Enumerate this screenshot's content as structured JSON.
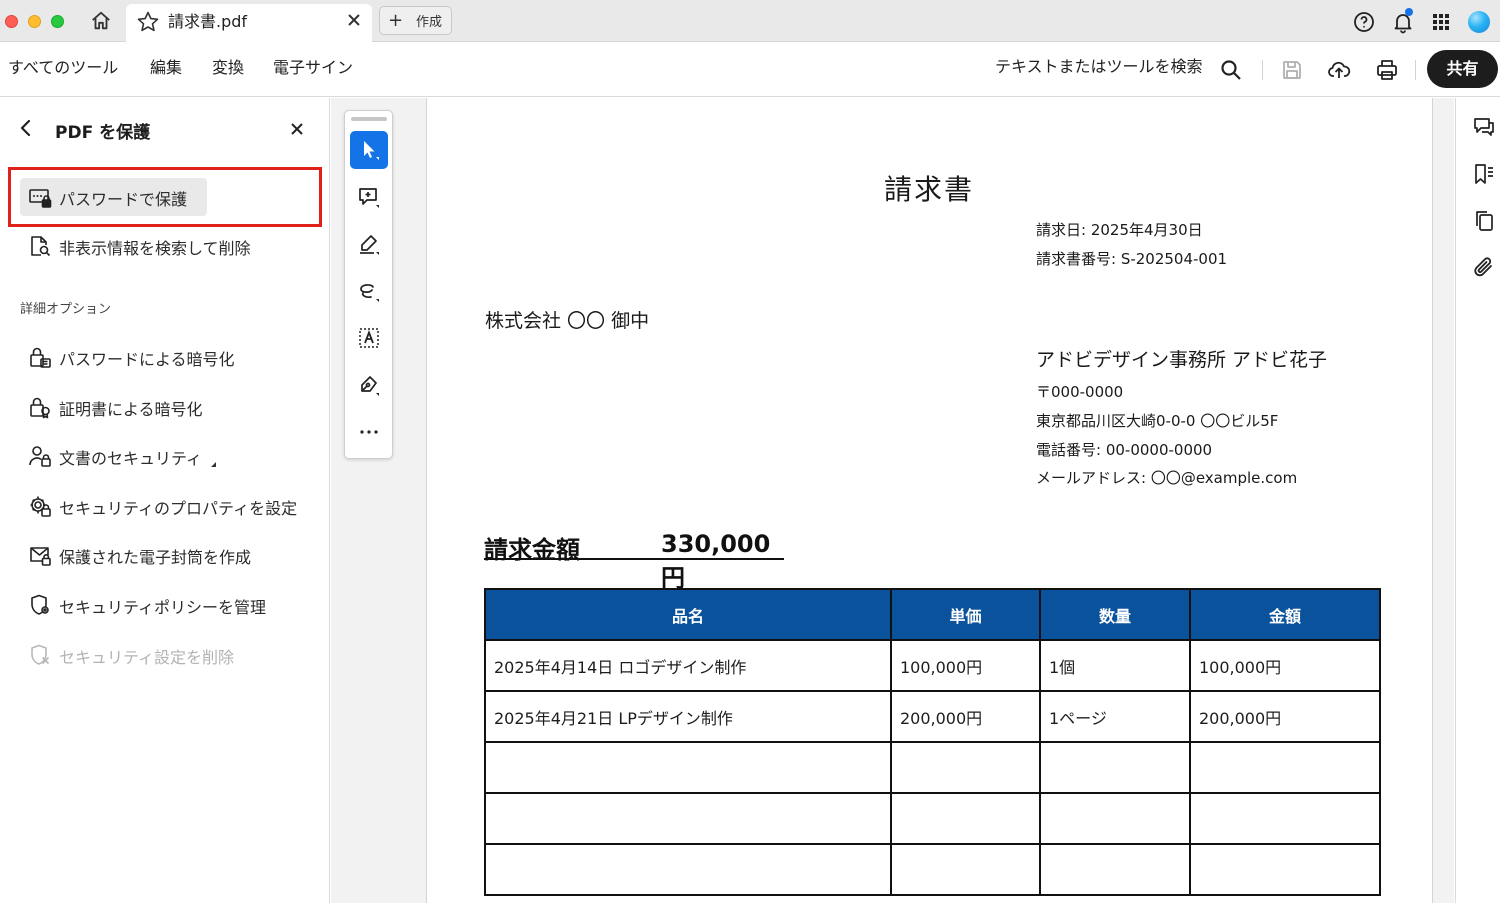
{
  "titlebar": {
    "tab_title": "請求書.pdf",
    "new_tab_label": "作成"
  },
  "menubar": {
    "items": [
      "すべてのツール",
      "編集",
      "変換",
      "電子サイン"
    ],
    "search_label": "テキストまたはツールを検索",
    "share_label": "共有"
  },
  "panel": {
    "title": "PDF を保護",
    "primary_items": [
      {
        "label": "パスワードで保護",
        "icon": "password-protect-icon",
        "selected": true
      },
      {
        "label": "非表示情報を検索して削除",
        "icon": "redact-search-icon"
      }
    ],
    "section_label": "詳細オプション",
    "advanced_items": [
      {
        "label": "パスワードによる暗号化",
        "icon": "lock-folder-icon"
      },
      {
        "label": "証明書による暗号化",
        "icon": "certificate-lock-icon"
      },
      {
        "label": "文書のセキュリティ",
        "icon": "user-lock-icon"
      },
      {
        "label": "セキュリティのプロパティを設定",
        "icon": "gear-lock-icon"
      },
      {
        "label": "保護された電子封筒を作成",
        "icon": "envelope-lock-icon"
      },
      {
        "label": "セキュリティポリシーを管理",
        "icon": "shield-gear-icon"
      },
      {
        "label": "セキュリティ設定を削除",
        "icon": "shield-remove-icon",
        "disabled": true
      }
    ]
  },
  "toolrail": {
    "tools": [
      "select-cursor-icon",
      "add-comment-icon",
      "highlight-pen-icon",
      "draw-lasso-icon",
      "text-recognition-icon",
      "signature-pen-icon",
      "more-icon"
    ]
  },
  "document": {
    "title": "請求書",
    "date_line": "請求日: 2025年4月30日",
    "number_line": "請求書番号: S-202504-001",
    "client": "株式会社 〇〇 御中",
    "sender_name": "アドビデザイン事務所 アドビ花子",
    "postal": "〒000-0000",
    "address": "東京都品川区大崎0-0-0 〇〇ビル5F",
    "phone": "電話番号: 00-0000-0000",
    "email": "メールアドレス: 〇〇@example.com",
    "amount_label": "請求金額",
    "amount_value": "330,000円",
    "table": {
      "headers": [
        "品名",
        "単価",
        "数量",
        "金額"
      ],
      "rows": [
        [
          "2025年4月14日 ロゴデザイン制作",
          "100,000円",
          "1個",
          "100,000円"
        ],
        [
          "2025年4月21日 LPデザイン制作",
          "200,000円",
          "1ページ",
          "200,000円"
        ],
        [
          "",
          "",
          "",
          ""
        ],
        [
          "",
          "",
          "",
          ""
        ],
        [
          "",
          "",
          "",
          ""
        ]
      ]
    }
  },
  "colors": {
    "accent": "#1473e6",
    "table_header": "#0a529b",
    "highlight_border": "#e0201a",
    "share_button": "#1d1d1d"
  }
}
